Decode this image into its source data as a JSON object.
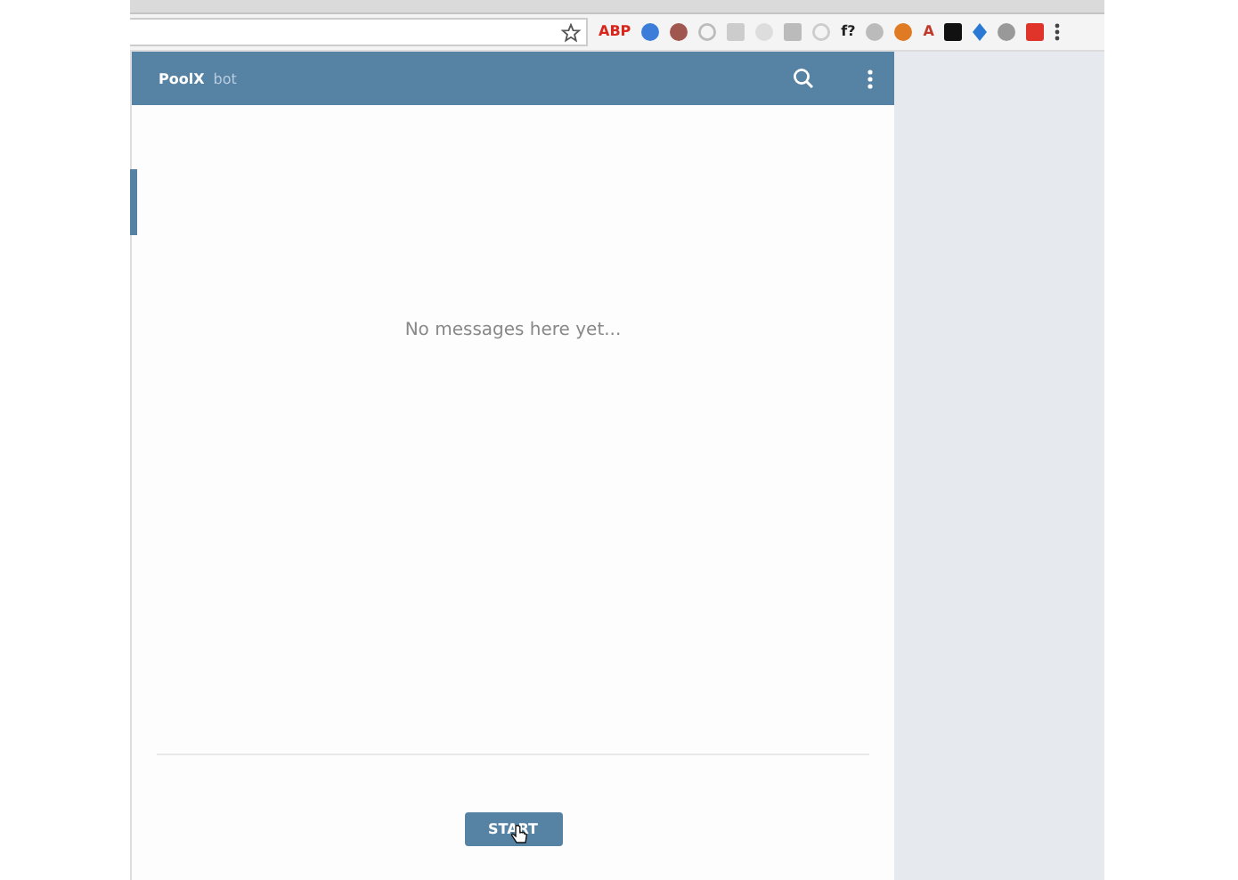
{
  "browser": {
    "extensions": [
      {
        "kind": "text",
        "label": "ABP",
        "color": "#d9261c"
      },
      {
        "kind": "dot",
        "color": "#3b7dd8"
      },
      {
        "kind": "dot",
        "color": "#a0574f"
      },
      {
        "kind": "ring",
        "color": "#bbbbbb"
      },
      {
        "kind": "square",
        "color": "#cccccc"
      },
      {
        "kind": "dot",
        "color": "#dddddd"
      },
      {
        "kind": "square",
        "color": "#bbbbbb"
      },
      {
        "kind": "ring",
        "color": "#cccccc"
      },
      {
        "kind": "text",
        "label": "f?",
        "color": "#222222"
      },
      {
        "kind": "dot",
        "color": "#bbbbbb"
      },
      {
        "kind": "dot",
        "color": "#e07b24"
      },
      {
        "kind": "text",
        "label": "A",
        "color": "#c0392b"
      },
      {
        "kind": "square",
        "color": "#111111"
      },
      {
        "kind": "diamond",
        "color": "#2a7ad5"
      },
      {
        "kind": "dot",
        "color": "#999999"
      },
      {
        "kind": "square",
        "color": "#e0342a"
      }
    ]
  },
  "chat": {
    "title": "PoolX",
    "subtitle": "bot",
    "empty_message": "No messages here yet...",
    "start_button": "START"
  }
}
